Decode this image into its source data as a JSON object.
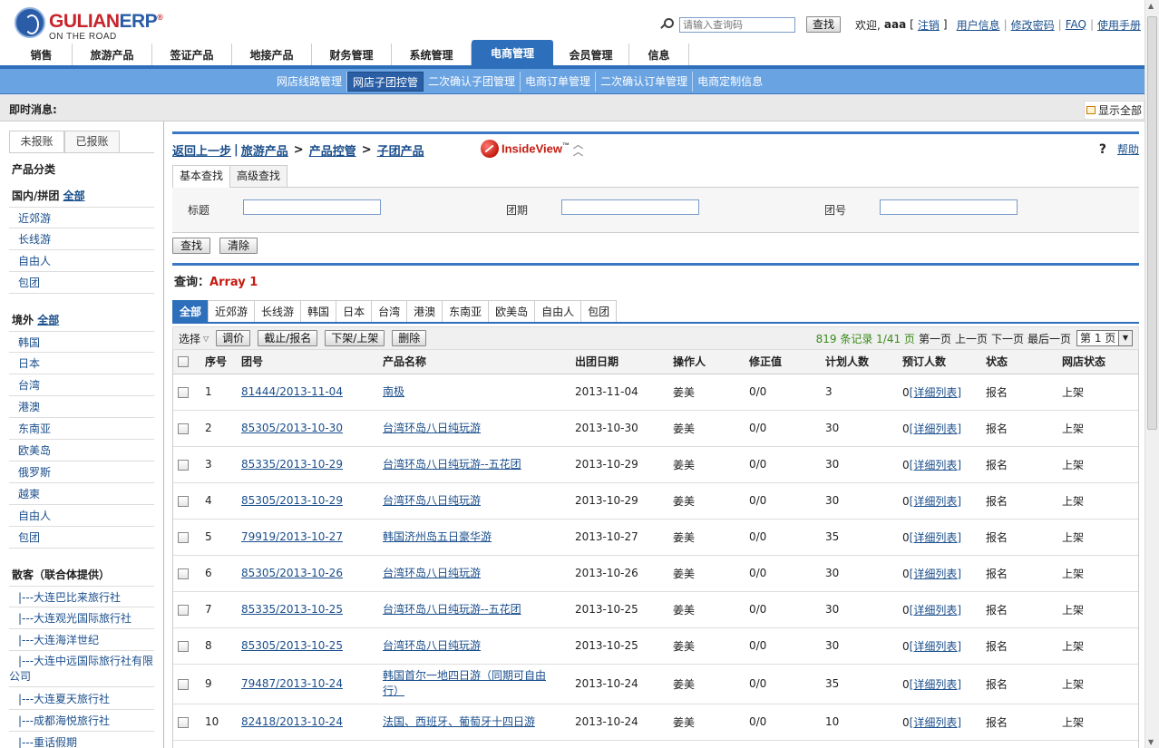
{
  "header": {
    "brand": "GULIANERP",
    "brand_red": "GULIAN",
    "brand_blue": "ERP",
    "tagline": "ON THE ROAD",
    "search_placeholder": "请输入查询码",
    "search_button": "查找",
    "welcome_prefix": "欢迎,",
    "username": "aaa",
    "logout": "注销",
    "user_info": "用户信息",
    "change_password": "修改密码",
    "faq": "FAQ",
    "manual": "使用手册",
    "bracket_open": "[",
    "bracket_close": "]",
    "sep": "|"
  },
  "main_nav": [
    {
      "label": "销售"
    },
    {
      "label": "旅游产品"
    },
    {
      "label": "签证产品"
    },
    {
      "label": "地接产品"
    },
    {
      "label": "财务管理"
    },
    {
      "label": "系统管理"
    },
    {
      "label": "电商管理",
      "active": true
    },
    {
      "label": "会员管理"
    },
    {
      "label": "信息"
    }
  ],
  "sub_nav": [
    {
      "label": "网店线路管理"
    },
    {
      "label": "网店子团控管",
      "active": true
    },
    {
      "label": "二次确认子团管理"
    },
    {
      "label": "电商订单管理"
    },
    {
      "label": "二次确认订单管理"
    },
    {
      "label": "电商定制信息"
    }
  ],
  "notice": {
    "label": "即时消息:",
    "show_all": "显示全部"
  },
  "sidebar": {
    "tabs": [
      "未报账",
      "已报账"
    ],
    "category_title": "产品分类",
    "domestic_label": "国内/拼团",
    "domestic_all": "全部",
    "domestic_items": [
      "近郊游",
      "长线游",
      "自由人",
      "包团"
    ],
    "abroad_label": "境外",
    "abroad_all": "全部",
    "abroad_items": [
      "韩国",
      "日本",
      "台湾",
      "港澳",
      "东南亚",
      "欧美岛",
      "俄罗斯",
      "越柬",
      "自由人",
      "包团"
    ],
    "retail_label": "散客（联合体提供）",
    "agencies": [
      "|---大连巴比来旅行社",
      "|---大连观光国际旅行社",
      "|---大连海洋世纪",
      "|---大连中远国际旅行社有限公司",
      "|---大连夏天旅行社",
      "|---成都海悦旅行社",
      "|---重话假期"
    ]
  },
  "content": {
    "breadcrumb": {
      "back": "返回上一步",
      "sep1": "|",
      "p1": "旅游产品",
      "p2": "产品控管",
      "p3": "子团产品",
      "gt": ">"
    },
    "insideview": "InsideView",
    "insideview_tm": "™",
    "help": "帮助",
    "help_q": "?",
    "search_tabs": [
      "基本查找",
      "高级查找"
    ],
    "search_fields": {
      "title": "标题",
      "date": "团期",
      "group_no": "团号"
    },
    "search_btn": "查找",
    "clear_btn": "清除",
    "query_label": "查询：",
    "query_value": "Array 1",
    "category_tabs": [
      "全部",
      "近郊游",
      "长线游",
      "韩国",
      "日本",
      "台湾",
      "港澳",
      "东南亚",
      "欧美岛",
      "自由人",
      "包团"
    ],
    "toolbar": {
      "select": "选择",
      "buttons": [
        "调价",
        "截止/报名",
        "下架/上架",
        "删除"
      ],
      "records": "819 条记录 1/41 页",
      "first": "第一页",
      "prev": "上一页",
      "next": "下一页",
      "last": "最后一页",
      "page_select": "第 1 页"
    },
    "columns": [
      "序号",
      "团号",
      "产品名称",
      "出团日期",
      "操作人",
      "修正值",
      "计划人数",
      "预订人数",
      "状态",
      "网店状态"
    ],
    "rows": [
      {
        "no": "1",
        "group": "81444/2013-11-04",
        "product": "南极",
        "date": "2013-11-04",
        "op": "姜美",
        "fix": "0/0",
        "plan": "3",
        "booked": "0",
        "detail": "[详细列表]",
        "status": "报名",
        "shop": "上架"
      },
      {
        "no": "2",
        "group": "85305/2013-10-30",
        "product": "台湾环岛八日纯玩游",
        "date": "2013-10-30",
        "op": "姜美",
        "fix": "0/0",
        "plan": "30",
        "booked": "0",
        "detail": "[详细列表]",
        "status": "报名",
        "shop": "上架"
      },
      {
        "no": "3",
        "group": "85335/2013-10-29",
        "product": "台湾环岛八日纯玩游--五花团",
        "date": "2013-10-29",
        "op": "姜美",
        "fix": "0/0",
        "plan": "30",
        "booked": "0",
        "detail": "[详细列表]",
        "status": "报名",
        "shop": "上架"
      },
      {
        "no": "4",
        "group": "85305/2013-10-29",
        "product": "台湾环岛八日纯玩游",
        "date": "2013-10-29",
        "op": "姜美",
        "fix": "0/0",
        "plan": "30",
        "booked": "0",
        "detail": "[详细列表]",
        "status": "报名",
        "shop": "上架"
      },
      {
        "no": "5",
        "group": "79919/2013-10-27",
        "product": "韩国济州岛五日豪华游",
        "date": "2013-10-27",
        "op": "姜美",
        "fix": "0/0",
        "plan": "35",
        "booked": "0",
        "detail": "[详细列表]",
        "status": "报名",
        "shop": "上架"
      },
      {
        "no": "6",
        "group": "85305/2013-10-26",
        "product": "台湾环岛八日纯玩游",
        "date": "2013-10-26",
        "op": "姜美",
        "fix": "0/0",
        "plan": "30",
        "booked": "0",
        "detail": "[详细列表]",
        "status": "报名",
        "shop": "上架"
      },
      {
        "no": "7",
        "group": "85335/2013-10-25",
        "product": "台湾环岛八日纯玩游--五花团",
        "date": "2013-10-25",
        "op": "姜美",
        "fix": "0/0",
        "plan": "30",
        "booked": "0",
        "detail": "[详细列表]",
        "status": "报名",
        "shop": "上架"
      },
      {
        "no": "8",
        "group": "85305/2013-10-25",
        "product": "台湾环岛八日纯玩游",
        "date": "2013-10-25",
        "op": "姜美",
        "fix": "0/0",
        "plan": "30",
        "booked": "0",
        "detail": "[详细列表]",
        "status": "报名",
        "shop": "上架"
      },
      {
        "no": "9",
        "group": "79487/2013-10-24",
        "product": "韩国首尔一地四日游（同期可自由行）",
        "date": "2013-10-24",
        "op": "姜美",
        "fix": "0/0",
        "plan": "35",
        "booked": "0",
        "detail": "[详细列表]",
        "status": "报名",
        "shop": "上架"
      },
      {
        "no": "10",
        "group": "82418/2013-10-24",
        "product": "法国、西班牙、葡萄牙十四日游",
        "date": "2013-10-24",
        "op": "姜美",
        "fix": "0/0",
        "plan": "10",
        "booked": "0",
        "detail": "[详细列表]",
        "status": "报名",
        "shop": "上架"
      }
    ]
  },
  "colors": {
    "nav_blue": "#2d6fba",
    "subnav_blue": "#6aa3e2",
    "brand_red": "#c8242b",
    "link": "#1a4e8c",
    "pager_green": "#3a8a1a",
    "query_red": "#c41a10"
  }
}
